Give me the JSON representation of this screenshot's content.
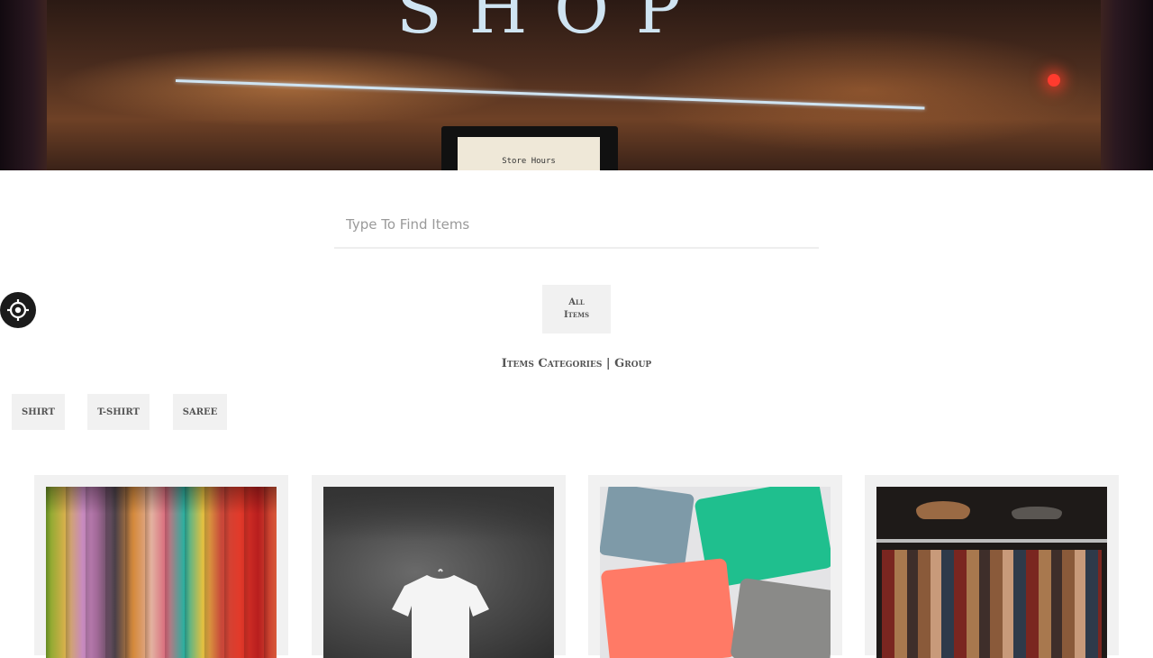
{
  "hero": {
    "sign_word": "SHOP",
    "store_hours": "Store Hours"
  },
  "search": {
    "placeholder": "Type To Find Items",
    "value": ""
  },
  "filters": {
    "all_line1": "All",
    "all_line2": "Items"
  },
  "categories": {
    "heading": "Items Categories | Group",
    "items": [
      {
        "label": "SHIRT"
      },
      {
        "label": "T-SHIRT"
      },
      {
        "label": "SAREE"
      }
    ]
  },
  "accessibility": {
    "icon": "accessibility-icon"
  },
  "products": [
    {
      "image": "scarves-photo"
    },
    {
      "image": "white-tshirt-photo"
    },
    {
      "image": "polo-shirts-photo"
    },
    {
      "image": "shirt-rack-photo"
    }
  ],
  "colors": {
    "button_bg": "#f1f1f1",
    "button_text": "#555555",
    "accessibility_bg": "#1b1b1b"
  }
}
